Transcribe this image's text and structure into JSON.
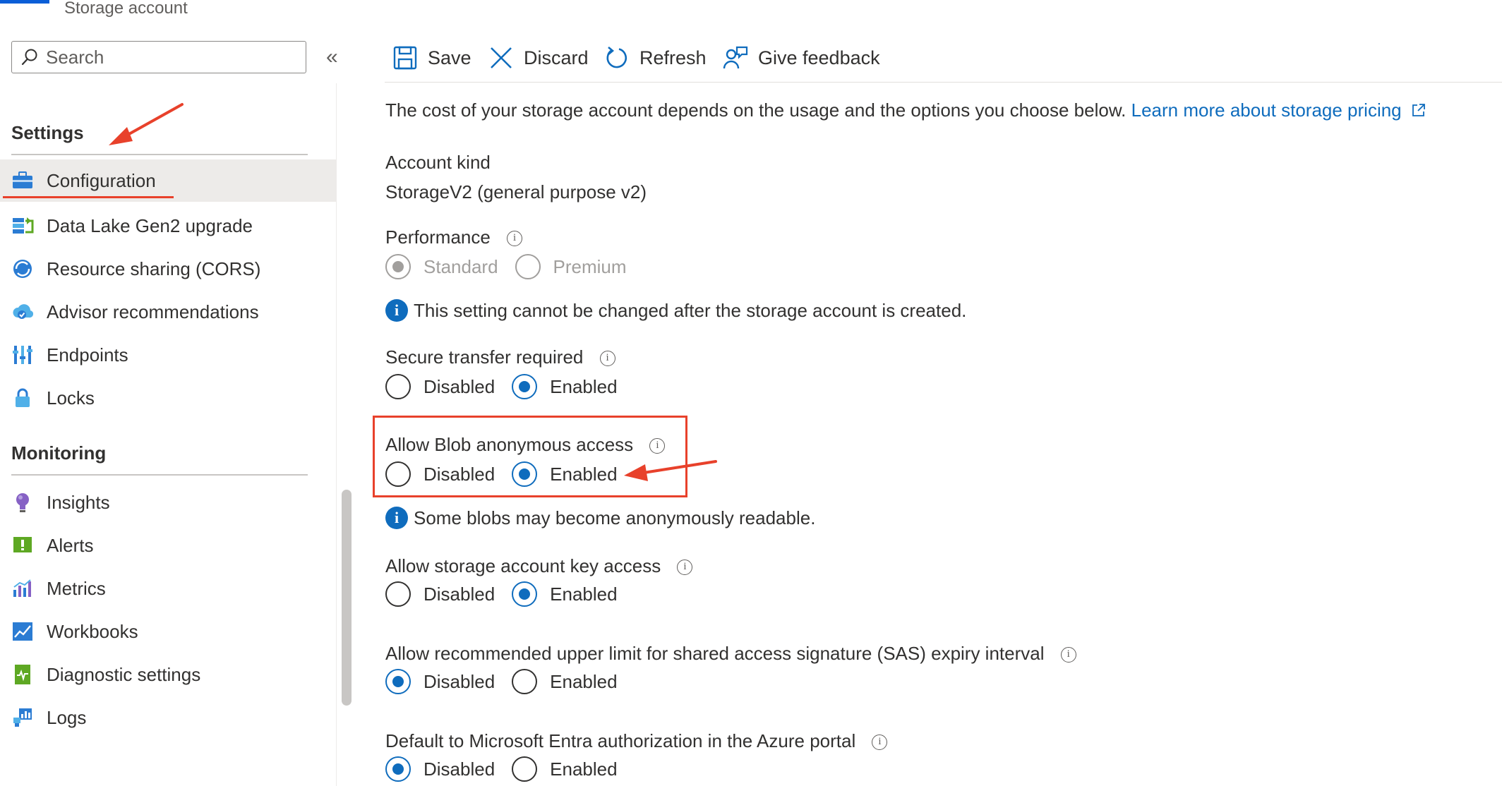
{
  "header": {
    "resource_type": "Storage account"
  },
  "search": {
    "placeholder": "Search"
  },
  "toolbar": {
    "save_label": "Save",
    "discard_label": "Discard",
    "refresh_label": "Refresh",
    "feedback_label": "Give feedback"
  },
  "sidebar": {
    "settings_heading": "Settings",
    "settings_items": [
      {
        "label": "Configuration",
        "icon": "briefcase-icon",
        "selected": true
      },
      {
        "label": "Data Lake Gen2 upgrade",
        "icon": "data-lake-icon"
      },
      {
        "label": "Resource sharing (CORS)",
        "icon": "cors-icon"
      },
      {
        "label": "Advisor recommendations",
        "icon": "advisor-icon"
      },
      {
        "label": "Endpoints",
        "icon": "endpoints-icon"
      },
      {
        "label": "Locks",
        "icon": "lock-icon"
      }
    ],
    "monitoring_heading": "Monitoring",
    "monitoring_items": [
      {
        "label": "Insights",
        "icon": "lightbulb-icon"
      },
      {
        "label": "Alerts",
        "icon": "alert-icon"
      },
      {
        "label": "Metrics",
        "icon": "metrics-icon"
      },
      {
        "label": "Workbooks",
        "icon": "workbooks-icon"
      },
      {
        "label": "Diagnostic settings",
        "icon": "diagnostic-icon"
      },
      {
        "label": "Logs",
        "icon": "logs-icon"
      }
    ]
  },
  "content": {
    "intro_text": "The cost of your storage account depends on the usage and the options you choose below.",
    "pricing_link": "Learn more about storage pricing",
    "account_kind_label": "Account kind",
    "account_kind_value": "StorageV2 (general purpose v2)",
    "performance_label": "Performance",
    "performance_options": [
      "Standard",
      "Premium"
    ],
    "performance_selected": "Standard",
    "performance_note": "This setting cannot be changed after the storage account is created.",
    "secure_transfer_label": "Secure transfer required",
    "blob_anon_label": "Allow Blob anonymous access",
    "blob_anon_note": "Some blobs may become anonymously readable.",
    "key_access_label": "Allow storage account key access",
    "sas_limit_label": "Allow recommended upper limit for shared access signature (SAS) expiry interval",
    "entra_label": "Default to Microsoft Entra authorization in the Azure portal",
    "disabled_label": "Disabled",
    "enabled_label": "Enabled",
    "secure_transfer_value": "Enabled",
    "blob_anon_value": "Enabled",
    "key_access_value": "Enabled",
    "sas_limit_value": "Disabled",
    "entra_value": "Disabled",
    "info_glyph": "i"
  },
  "colors": {
    "accent": "#0f6cbd",
    "annotation": "#e8412b"
  }
}
